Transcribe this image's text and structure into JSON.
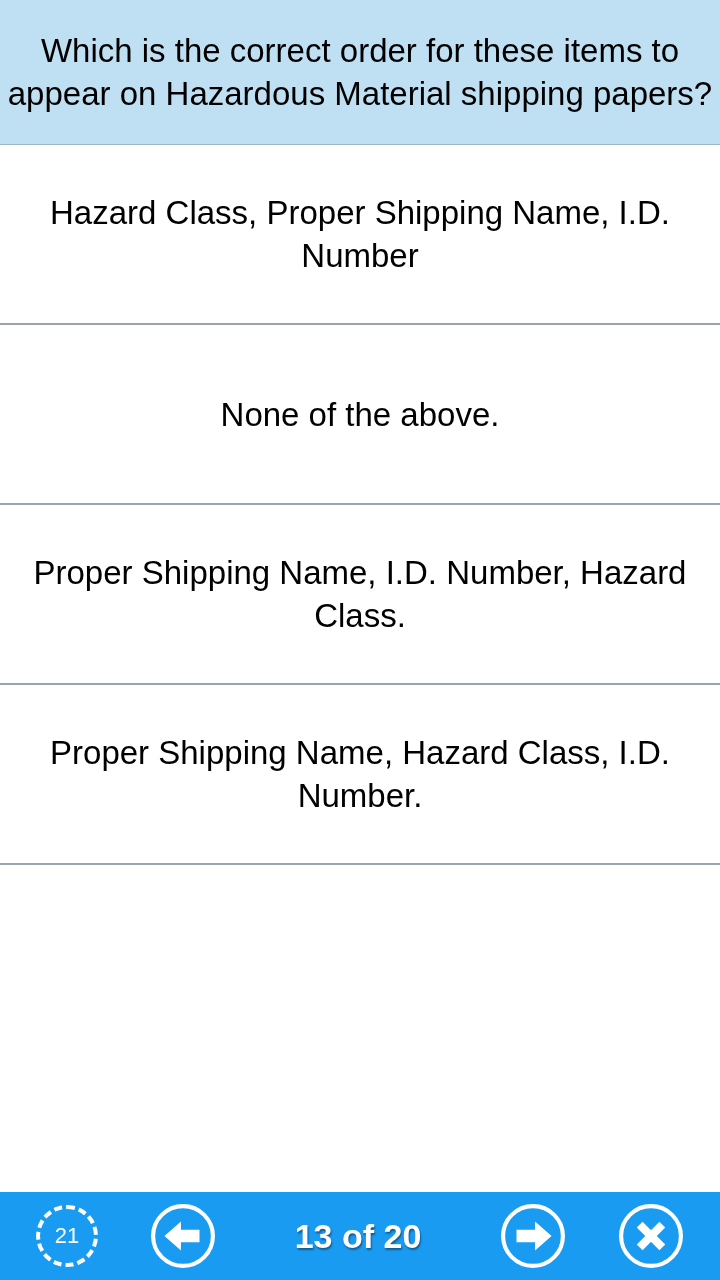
{
  "question": "Which is the correct order for these items to appear on Hazardous Material shipping papers?",
  "answers": [
    {
      "text": "Hazard Class, Proper Shipping Name, I.D. Number"
    },
    {
      "text": "None of the above."
    },
    {
      "text": "Proper Shipping Name, I.D. Number, Hazard Class."
    },
    {
      "text": "Proper Shipping Name, Hazard Class, I.D. Number."
    }
  ],
  "bottom_bar": {
    "timer": "21",
    "progress": "13 of 20"
  }
}
